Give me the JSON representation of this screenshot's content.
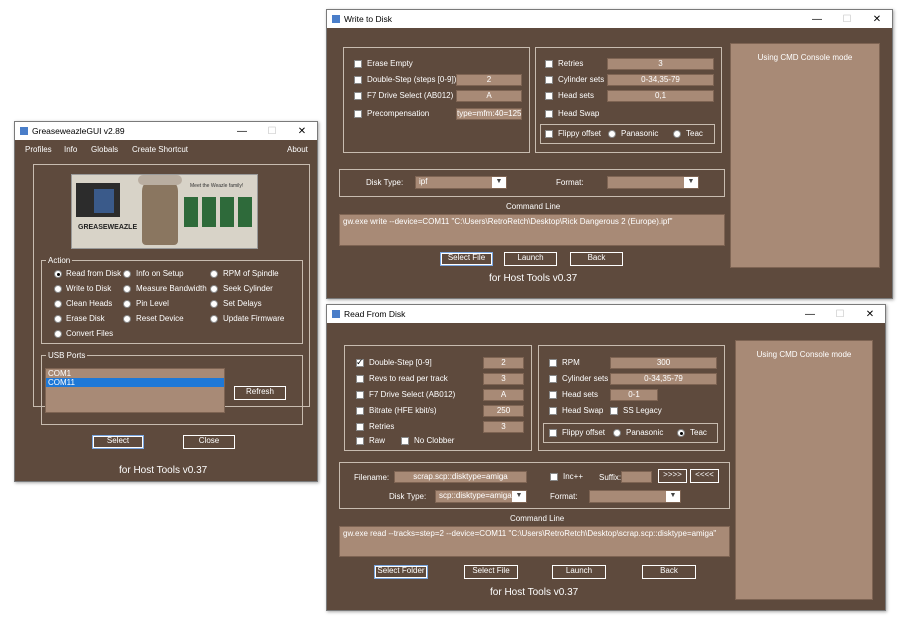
{
  "gui": {
    "title": "GreaseweazleGUI v2.89",
    "menu": [
      "Profiles",
      "Info",
      "Globals",
      "Create Shortcut",
      "About"
    ],
    "banner": {
      "brand": "GREASEWEAZLE",
      "tag": "Meet the Weazle family!"
    },
    "action_legend": "Action",
    "actions": [
      {
        "label": "Read from Disk",
        "selected": true
      },
      {
        "label": "Write to Disk",
        "selected": false
      },
      {
        "label": "Clean Heads",
        "selected": false
      },
      {
        "label": "Erase Disk",
        "selected": false
      },
      {
        "label": "Convert Files",
        "selected": false
      },
      {
        "label": "Info on Setup",
        "selected": false
      },
      {
        "label": "Measure Bandwidth",
        "selected": false
      },
      {
        "label": "Pin Level",
        "selected": false
      },
      {
        "label": "Reset Device",
        "selected": false
      },
      {
        "label": "RPM of Spindle",
        "selected": false
      },
      {
        "label": "Seek Cylinder",
        "selected": false
      },
      {
        "label": "Set Delays",
        "selected": false
      },
      {
        "label": "Update Firmware",
        "selected": false
      }
    ],
    "usb_legend": "USB Ports",
    "ports": [
      "COM1",
      "COM11"
    ],
    "selected_port": "COM11",
    "refresh": "Refresh",
    "select": "Select",
    "close": "Close",
    "footer": "for Host Tools v0.37"
  },
  "write": {
    "title": "Write to Disk",
    "erase_empty": "Erase Empty",
    "double_step": "Double-Step (steps [0-9])",
    "double_step_val": "2",
    "f7": "F7 Drive Select (AB012)",
    "f7_val": "A",
    "precomp": "Precompensation",
    "precomp_val": "type=mfm:40=125",
    "retries": "Retries",
    "retries_val": "3",
    "cyl_sets": "Cylinder sets",
    "cyl_val": "0-34,35-79",
    "head_sets": "Head sets",
    "head_val": "0,1",
    "head_swap": "Head Swap",
    "flippy": "Flippy offset",
    "panasonic": "Panasonic",
    "teac": "Teac",
    "disk_type_lbl": "Disk Type:",
    "disk_type": "ipf",
    "format_lbl": "Format:",
    "format": "",
    "cmd_lbl": "Command Line",
    "cmd": "gw.exe write --device=COM11 \"C:\\Users\\RetroRetch\\Desktop\\Rick Dangerous 2 (Europe).ipf\"",
    "select_file": "Select File",
    "launch": "Launch",
    "back": "Back",
    "console": "Using CMD Console mode",
    "footer": "for Host Tools v0.37"
  },
  "read": {
    "title": "Read From Disk",
    "double_step": "Double-Step [0-9]",
    "double_step_val": "2",
    "revs": "Revs to read per track",
    "revs_val": "3",
    "f7": "F7 Drive Select (AB012)",
    "f7_val": "A",
    "bitrate": "Bitrate (HFE kbit/s)",
    "bitrate_val": "250",
    "retries": "Retries",
    "retries_val": "3",
    "raw": "Raw",
    "no_clobber": "No Clobber",
    "rpm": "RPM",
    "rpm_val": "300",
    "cyl_sets": "Cylinder sets",
    "cyl_val": "0-34,35-79",
    "head_sets": "Head sets",
    "head_val": "0-1",
    "head_swap": "Head Swap",
    "ss_legacy": "SS Legacy",
    "flippy": "Flippy offset",
    "panasonic": "Panasonic",
    "teac": "Teac",
    "filename_lbl": "Filename:",
    "filename": "scrap.scp::disktype=amiga",
    "inc": "Inc++",
    "suffix_lbl": "Suffix:",
    "fwd": ">>>>",
    "back_arrows": "<<<<",
    "disk_type_lbl": "Disk Type:",
    "disk_type": "scp::disktype=amiga",
    "format_lbl": "Format:",
    "format": "",
    "cmd_lbl": "Command Line",
    "cmd": "gw.exe read --tracks=step=2 --device=COM11 \"C:\\Users\\RetroRetch\\Desktop\\scrap.scp::disktype=amiga\"",
    "select_folder": "Select Folder",
    "select_file": "Select File",
    "launch": "Launch",
    "back": "Back",
    "console": "Using CMD Console mode",
    "footer": "for Host Tools v0.37"
  },
  "titlebar_buttons": {
    "min": "—",
    "max": "☐",
    "close": "✕"
  }
}
